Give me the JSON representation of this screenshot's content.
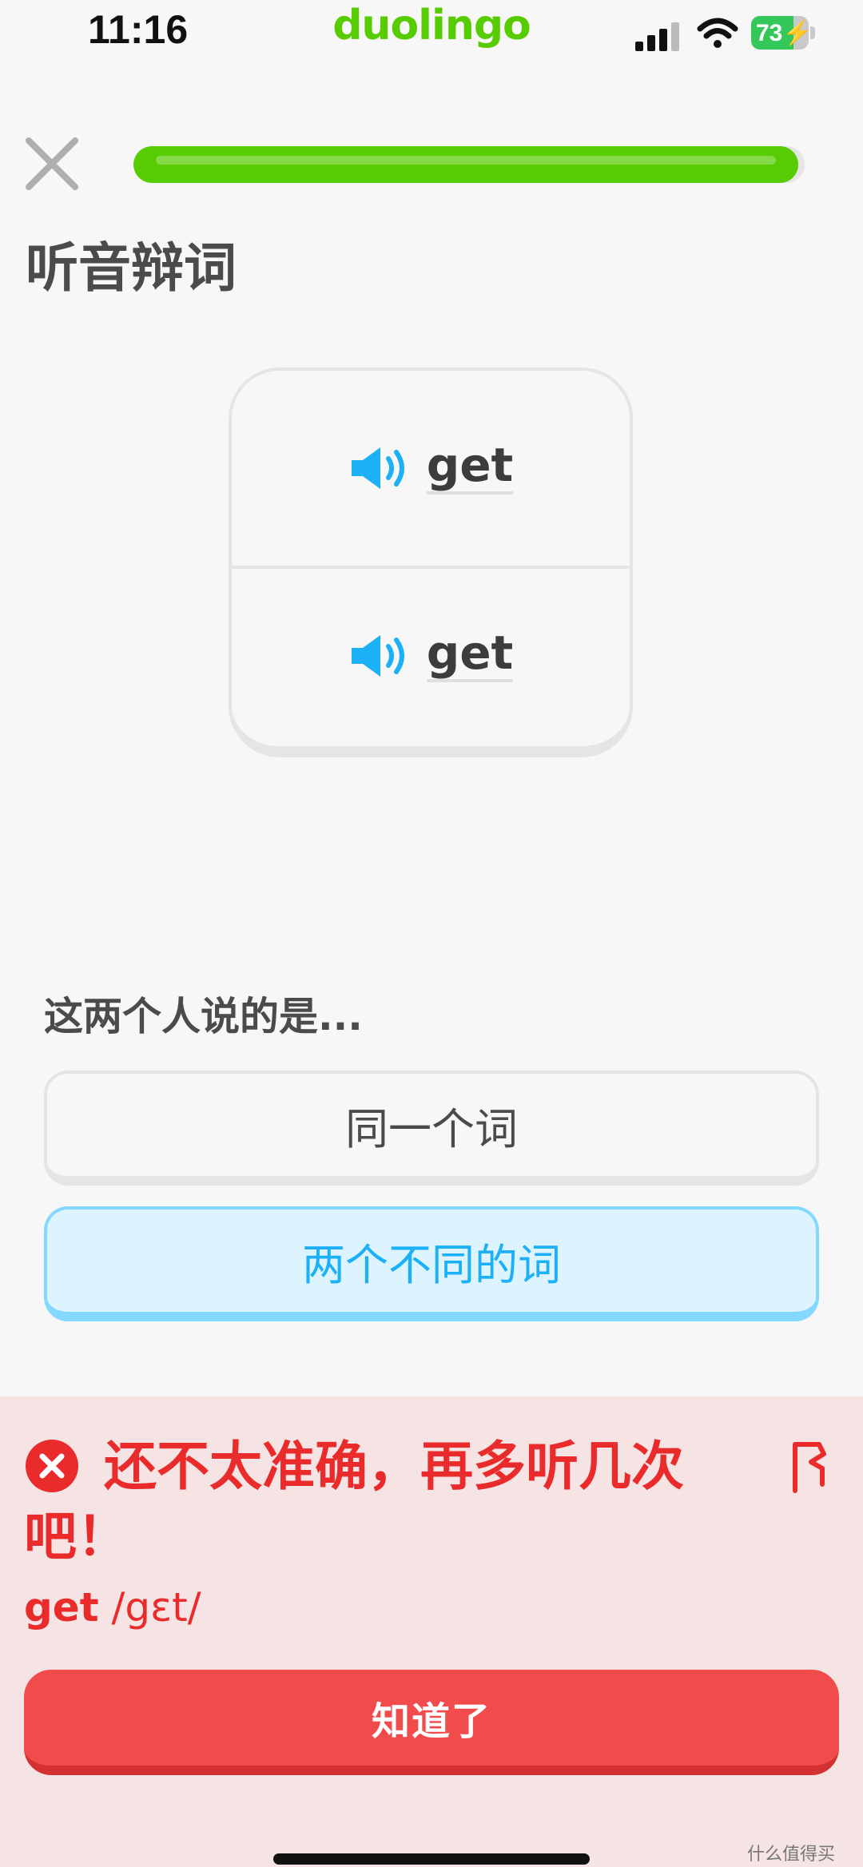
{
  "status_bar": {
    "time": "11:16",
    "brand": "duolingo",
    "battery": "73",
    "battery_level": 0.73,
    "icons": [
      "signal-bars-icon",
      "wifi-icon",
      "battery-charging-icon"
    ]
  },
  "header": {
    "close_icon": "close-icon",
    "progress_fraction": 0.99
  },
  "prompt": {
    "title": "听音辩词"
  },
  "audio_card": {
    "items": [
      {
        "word": "get",
        "icon": "speaker-icon"
      },
      {
        "word": "get",
        "icon": "speaker-icon"
      }
    ]
  },
  "question": {
    "text": "这两个人说的是...",
    "options": [
      {
        "label": "同一个词",
        "selected": false
      },
      {
        "label": "两个不同的词",
        "selected": true
      }
    ]
  },
  "feedback": {
    "message": "还不太准确，再多听几次吧！",
    "answer_word": "get",
    "answer_ipa": "/gɛt/",
    "continue_label": "知道了",
    "icons": [
      "error-x-icon",
      "report-flag-icon"
    ]
  },
  "watermark": "什么值得买",
  "colors": {
    "green": "#58cc02",
    "blue": "#1cb0f6",
    "red": "#ea2b2b",
    "button_red": "#f24b4b"
  }
}
